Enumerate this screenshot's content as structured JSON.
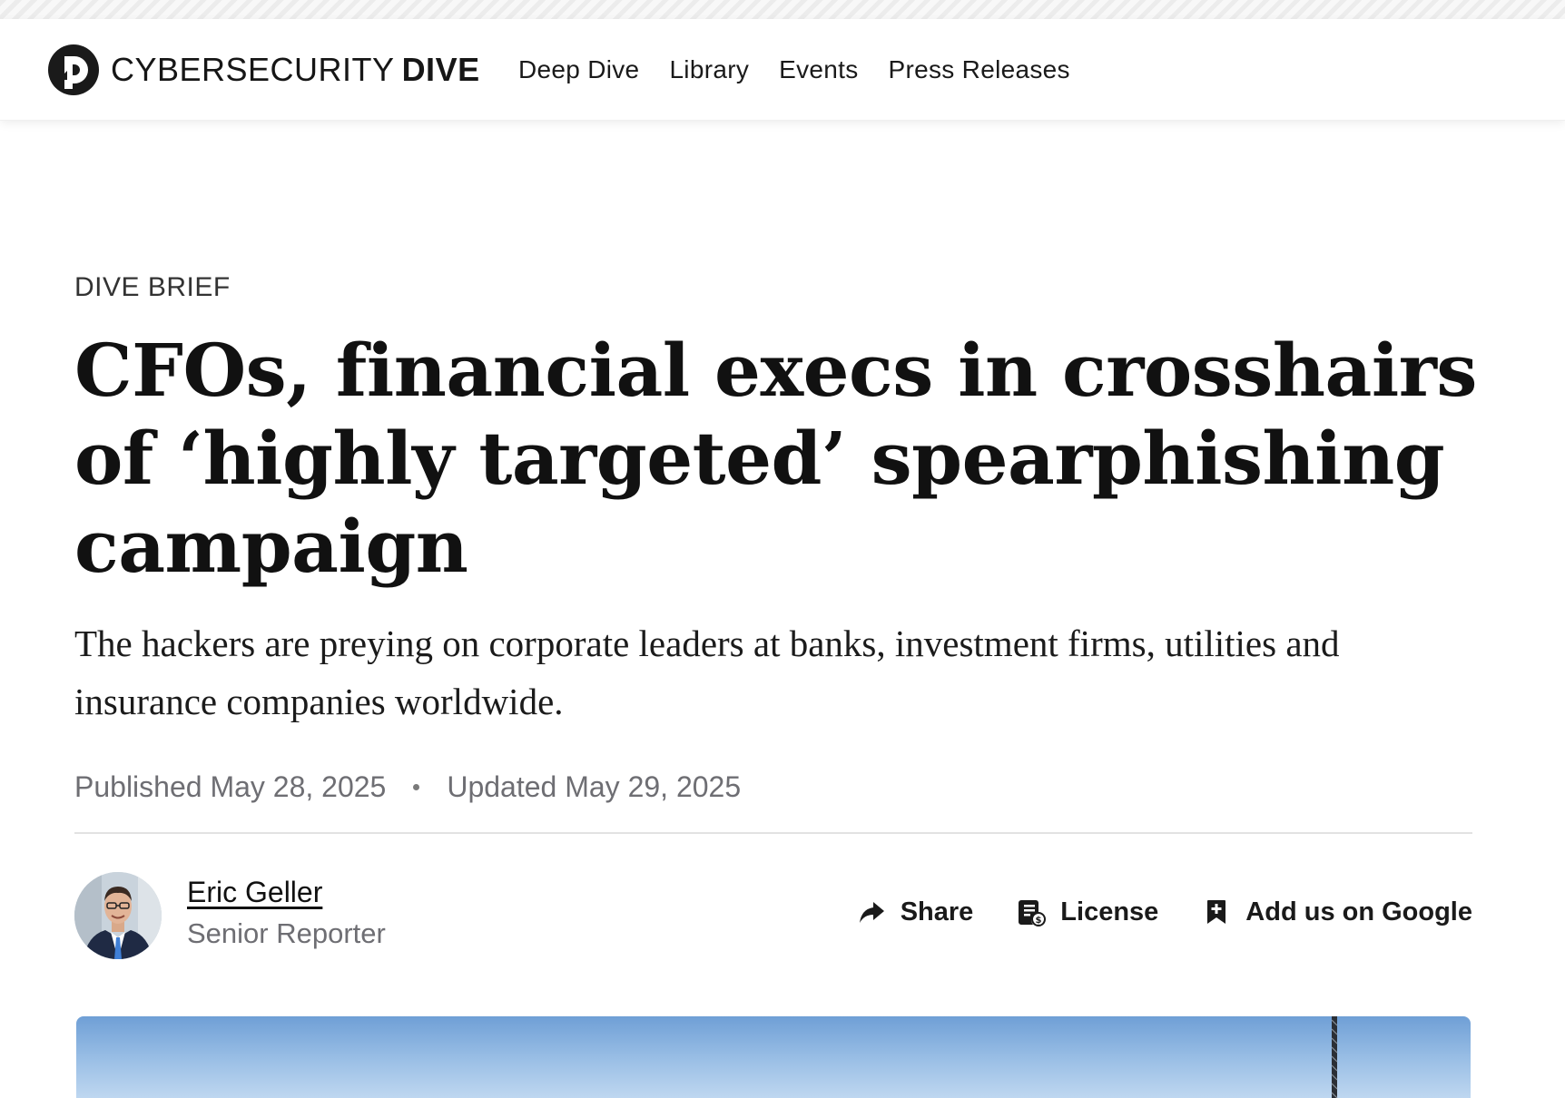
{
  "header": {
    "brand_light": "CYBERSECURITY",
    "brand_bold": "DIVE",
    "nav": [
      {
        "label": "Deep Dive"
      },
      {
        "label": "Library"
      },
      {
        "label": "Events"
      },
      {
        "label": "Press Releases"
      }
    ]
  },
  "article": {
    "kicker": "DIVE BRIEF",
    "headline": "CFOs, financial execs in crosshairs of ‘highly targeted’ spearphishing campaign",
    "dek": "The hackers are preying on corporate leaders at banks, investment firms, utilities and insurance companies worldwide.",
    "published": "Published May 28, 2025",
    "updated": "Updated May 29, 2025"
  },
  "byline": {
    "author_name": "Eric Geller",
    "author_title": "Senior Reporter"
  },
  "actions": {
    "share": {
      "label": "Share",
      "icon": "share-arrow-icon"
    },
    "license": {
      "label": "License",
      "icon": "license-document-icon"
    },
    "google": {
      "label": "Add us on Google",
      "icon": "bookmark-plus-icon"
    }
  },
  "colors": {
    "text": "#111111",
    "muted": "#6e6e73",
    "rule": "#e2e2e2",
    "hero_sky": "#9cc0e6"
  }
}
